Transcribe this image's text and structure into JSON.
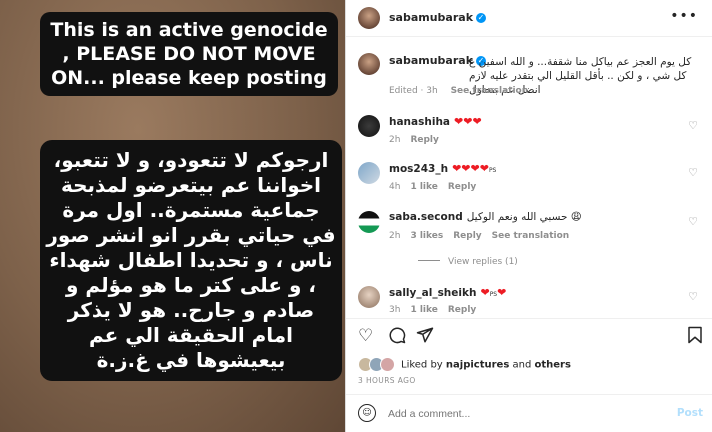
{
  "story": {
    "english_text": "This is an active genocide , PLEASE DO NOT MOVE ON... please keep posting",
    "arabic_text": "ارجوكم لا تتعودو، و لا تتعبو، اخواننا عم بيتعرضو لمذبحة جماعية مستمرة.. اول مرة في حياتي بقرر انو انشر صور ناس ، و تحديدا اطفال شهداء ، و على كتر ما هو مؤلم و صادم و جارح.. هو لا يذكر امام الحقيقة الي عم بيعيشوها في غ.ز.ة"
  },
  "header": {
    "username": "sabamubarak",
    "more_icon": "more-horizontal-icon"
  },
  "caption": {
    "username": "sabamubarak",
    "text": "كل يوم العجز عم بياكل منا شقفة... و الله اسفين ع كل شي ، و لكن .. بأقل القليل الي بتقدر عليه لازم انضل عم بنحاول",
    "edited": "Edited · 3h",
    "see_translation": "See translation"
  },
  "comments": [
    {
      "username": "hanashiha",
      "text": "❤❤❤",
      "time": "2h",
      "likes": "",
      "reply": "Reply",
      "translation": "",
      "ps": false
    },
    {
      "username": "mos243_h",
      "text": "❤❤❤❤",
      "time": "4h",
      "likes": "1 like",
      "reply": "Reply",
      "translation": "",
      "ps": true
    },
    {
      "username": "saba.second",
      "text": "حسبي الله ونعم الوكيل 😩",
      "time": "2h",
      "likes": "3 likes",
      "reply": "Reply",
      "translation": "See translation",
      "ps": false
    },
    {
      "username": "sally_al_sheikh",
      "text": "❤",
      "time": "3h",
      "likes": "1 like",
      "reply": "Reply",
      "translation": "",
      "ps": true,
      "text2": "❤"
    }
  ],
  "view_replies": "View replies (1)",
  "likes": {
    "prefix": "Liked by",
    "user": "najpictures",
    "mid": "and",
    "others": "others"
  },
  "time_ago": "3 HOURS AGO",
  "add_comment": {
    "placeholder": "Add a comment...",
    "post_label": "Post"
  },
  "colors": {
    "verified": "#0095f6",
    "heart": "#ed1c24",
    "muted": "#8e8e8e",
    "post_disabled": "#b2dffc"
  }
}
